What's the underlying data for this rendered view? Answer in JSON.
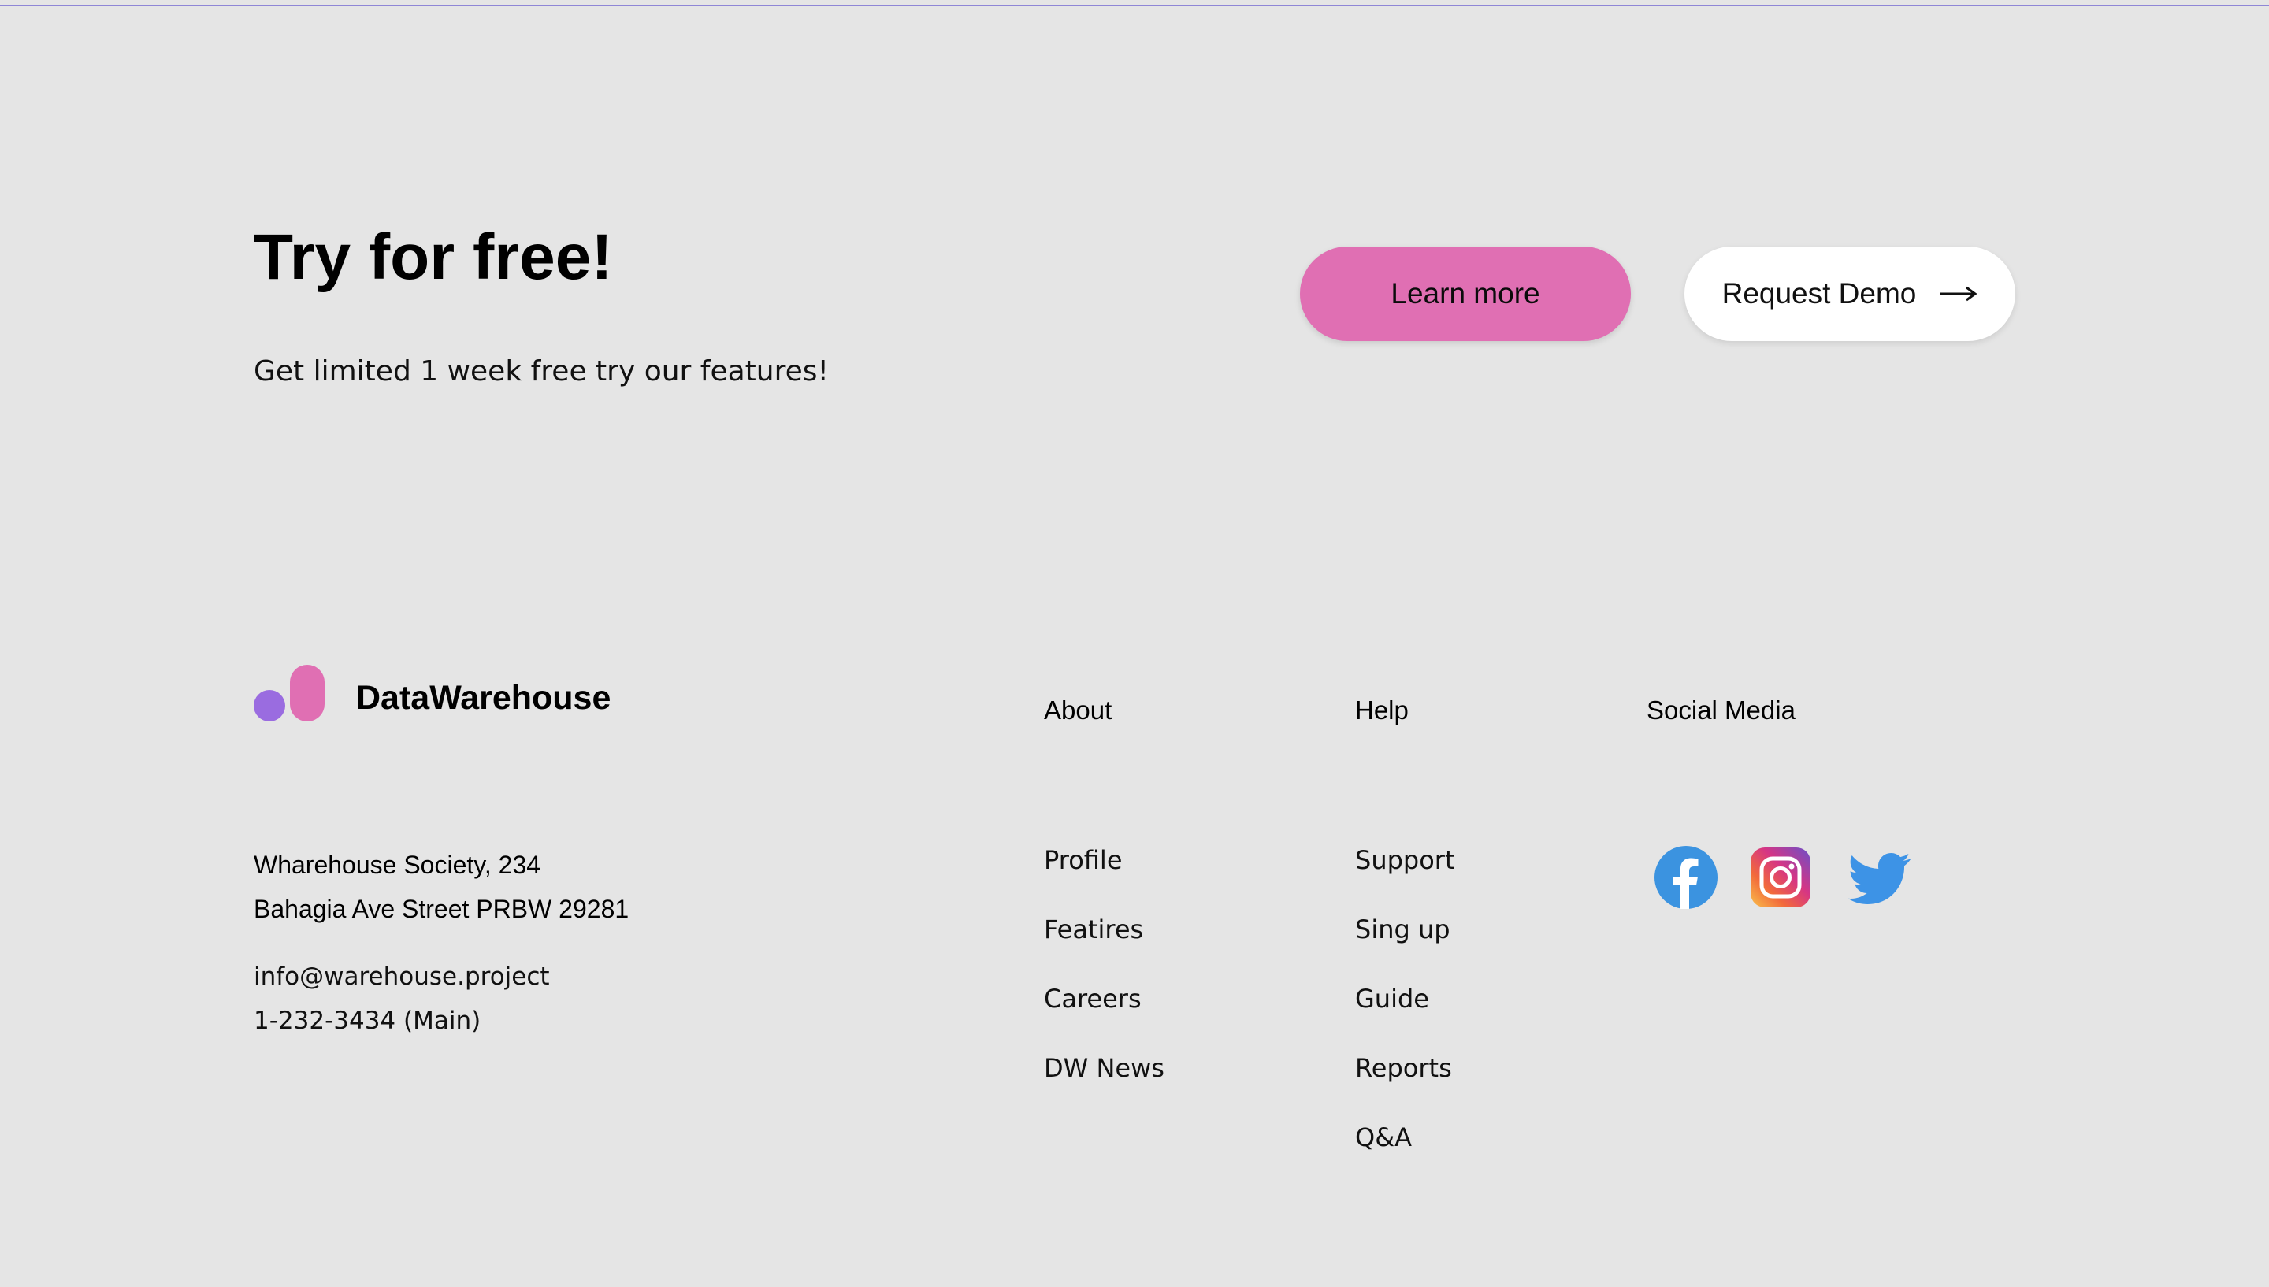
{
  "cta": {
    "title": "Try for free!",
    "subtitle": "Get limited 1 week free try our features!",
    "learn_more_label": "Learn more",
    "request_demo_label": "Request Demo"
  },
  "brand": {
    "name": "DataWarehouse",
    "logo_colors": [
      "#9a6ce0",
      "#e06fb3"
    ]
  },
  "contact": {
    "address_line1": "Wharehouse Society, 234",
    "address_line2": "Bahagia Ave Street PRBW 29281",
    "email": "info@warehouse.project",
    "phone": "1-232-3434 (Main)"
  },
  "footer": {
    "about": {
      "heading": "About",
      "links": [
        "Profile",
        "Featires",
        "Careers",
        "DW News"
      ]
    },
    "help": {
      "heading": "Help",
      "links": [
        "Support",
        "Sing up",
        "Guide",
        "Reports",
        "Q&A"
      ]
    },
    "social": {
      "heading": "Social Media",
      "icons": [
        "facebook-icon",
        "instagram-icon",
        "twitter-icon"
      ]
    }
  },
  "colors": {
    "background": "#e5e5e5",
    "accent_pink": "#e06fb3",
    "accent_purple": "#9a6ce0",
    "facebook_blue": "#3b93e0",
    "twitter_blue": "#3d93e6"
  }
}
